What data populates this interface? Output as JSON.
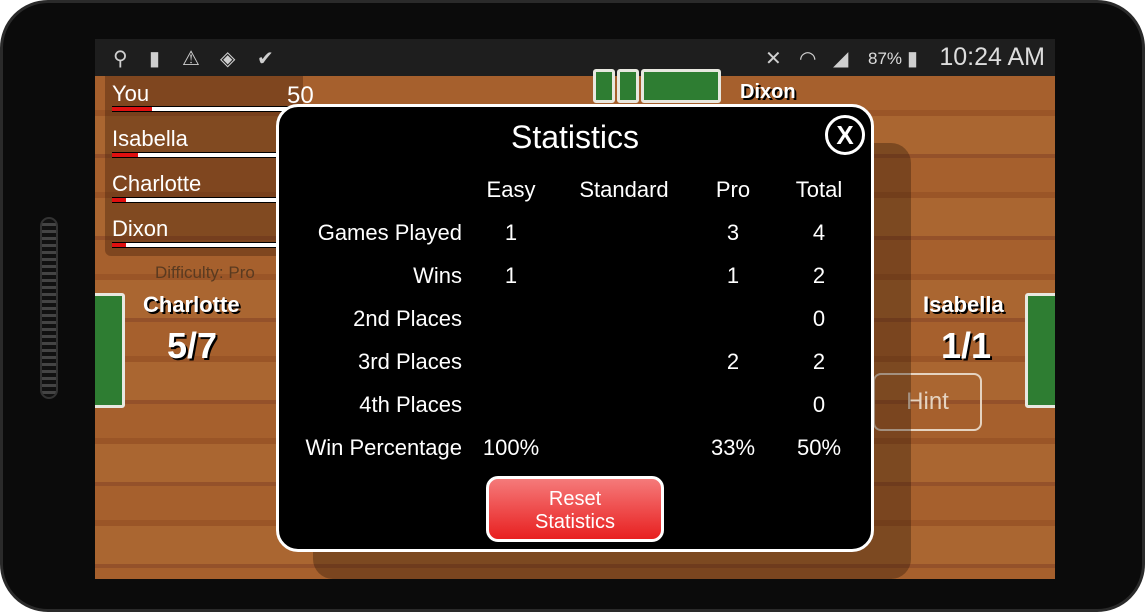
{
  "status_bar": {
    "icons": [
      "usb-icon",
      "keyhole-icon",
      "warning-icon",
      "vpn-shield-icon",
      "checkmark-flag-icon",
      "mute-icon",
      "wifi-icon",
      "signal-icon",
      "battery-charging-icon"
    ],
    "battery": "87%",
    "time": "10:24 AM"
  },
  "scoreboard": {
    "score": "50",
    "players": [
      {
        "name": "You",
        "progress": 0.2
      },
      {
        "name": "Isabella",
        "progress": 0.13
      },
      {
        "name": "Charlotte",
        "progress": 0.07
      },
      {
        "name": "Dixon",
        "progress": 0.07
      }
    ],
    "difficulty": "Difficulty: Pro"
  },
  "table": {
    "left_player": {
      "name": "Charlotte",
      "score": "5/7"
    },
    "right_player": {
      "name": "Isabella",
      "score": "1/1"
    },
    "top_player": {
      "name": "Dixon"
    },
    "hint_label": "Hint"
  },
  "dialog": {
    "title": "Statistics",
    "close_label": "X",
    "columns": [
      "Easy",
      "Standard",
      "Pro",
      "Total"
    ],
    "rows": [
      {
        "label": "Games Played",
        "values": [
          "1",
          "",
          "3",
          "4"
        ]
      },
      {
        "label": "Wins",
        "values": [
          "1",
          "",
          "1",
          "2"
        ]
      },
      {
        "label": "2nd Places",
        "values": [
          "",
          "",
          "",
          "0"
        ]
      },
      {
        "label": "3rd Places",
        "values": [
          "",
          "",
          "2",
          "2"
        ]
      },
      {
        "label": "4th Places",
        "values": [
          "",
          "",
          "",
          "0"
        ]
      },
      {
        "label": "Win Percentage",
        "values": [
          "100%",
          "",
          "33%",
          "50%"
        ]
      }
    ],
    "reset_label_1": "Reset",
    "reset_label_2": "Statistics"
  }
}
